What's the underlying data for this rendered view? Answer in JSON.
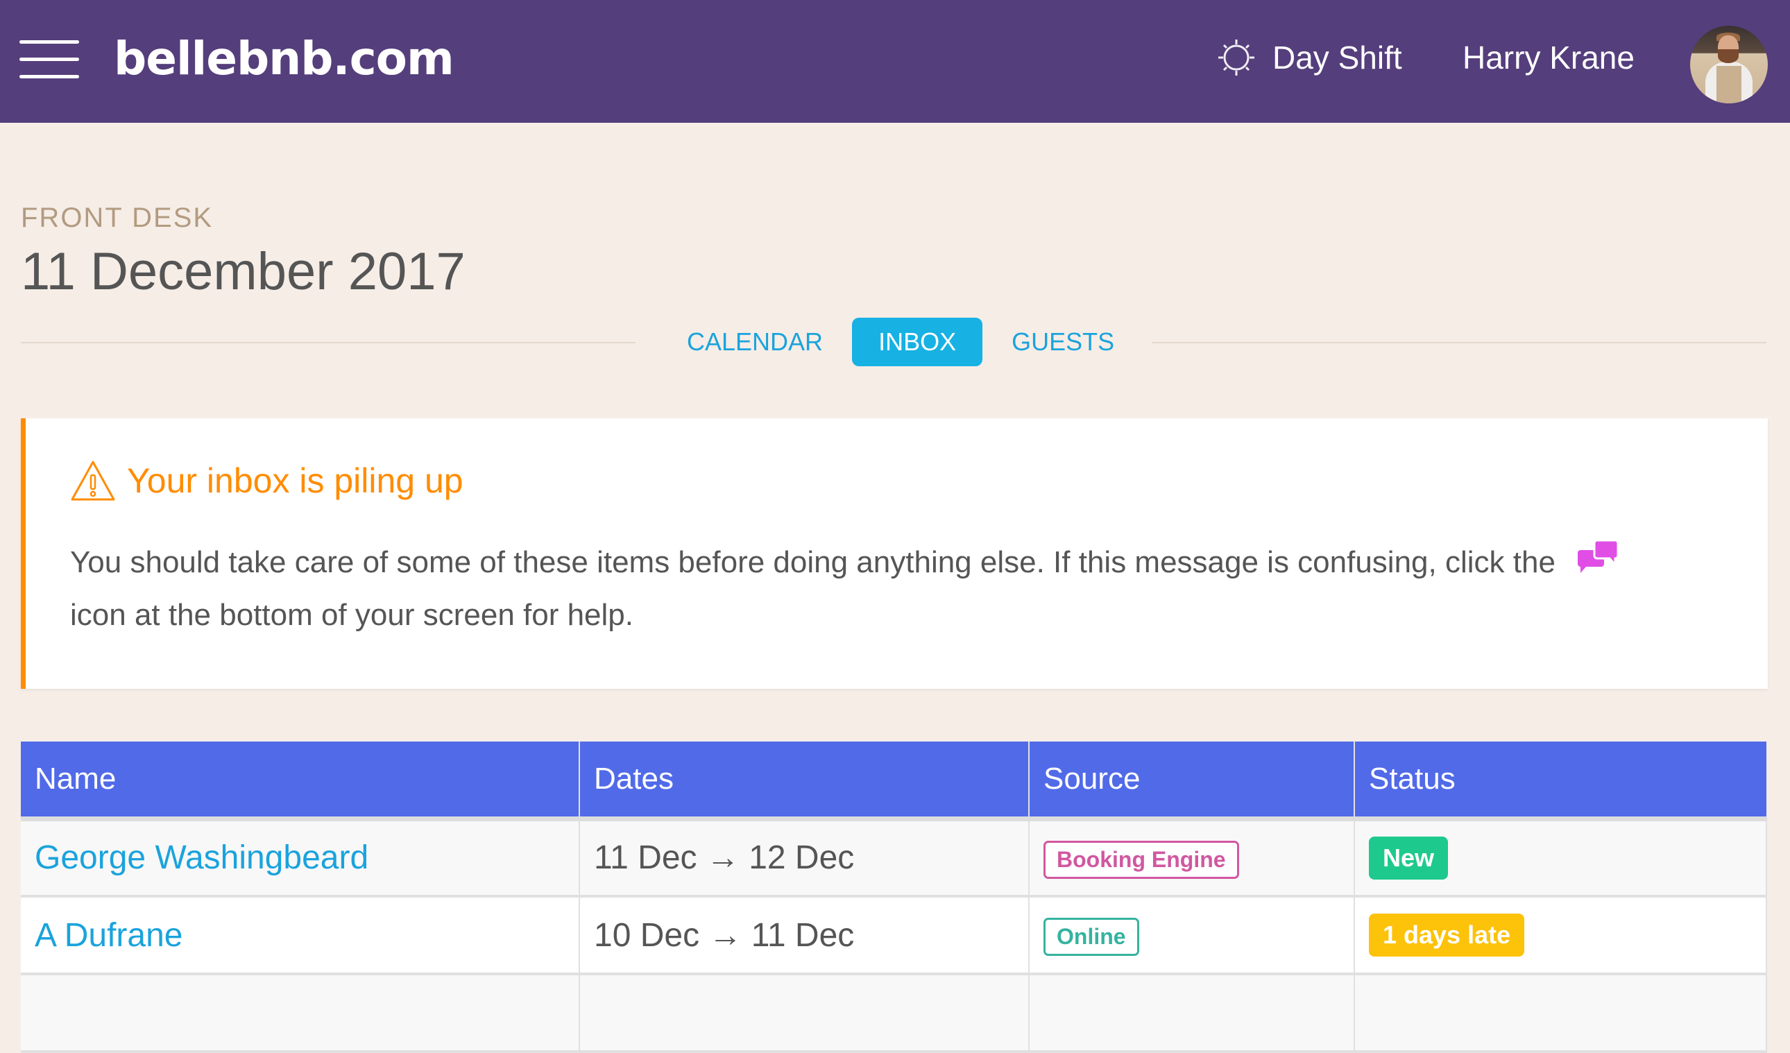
{
  "header": {
    "brand": "bellebnb.com",
    "shift_label": "Day Shift",
    "user_name": "Harry Krane",
    "menu_icon": "hamburger-menu-icon",
    "shift_icon": "sun-icon",
    "colors": {
      "bar": "#553e7c"
    }
  },
  "page": {
    "eyebrow": "FRONT DESK",
    "title": "11 December 2017"
  },
  "tabs": [
    {
      "label": "CALENDAR",
      "active": false
    },
    {
      "label": "INBOX",
      "active": true
    },
    {
      "label": "GUESTS",
      "active": false
    }
  ],
  "alert": {
    "icon": "warning-triangle-icon",
    "title": "Your inbox is piling up",
    "body_before_icon": "You should take care of some of these items before doing anything else. If this message is confusing, click the",
    "body_after_icon": "icon at the bottom of your screen for help.",
    "inline_icon": "chat-bubbles-icon",
    "colors": {
      "accent": "#ff8c00",
      "chat_icon": "#e04ee6"
    }
  },
  "table": {
    "columns": [
      "Name",
      "Dates",
      "Source",
      "Status"
    ],
    "rows": [
      {
        "name": "George Washingbeard",
        "dates": "11 Dec → 12 Dec",
        "source": {
          "label": "Booking Engine",
          "color": "#d058a0"
        },
        "status": {
          "label": "New",
          "color": "#1ec98e"
        }
      },
      {
        "name": "A Dufrane",
        "dates": "10 Dec → 11 Dec",
        "source": {
          "label": "Online",
          "color": "#35b3a0"
        },
        "status": {
          "label": "1 days late",
          "color": "#fdc20a"
        }
      }
    ],
    "colors": {
      "header": "#516ae8",
      "link": "#1aa3dc"
    }
  }
}
